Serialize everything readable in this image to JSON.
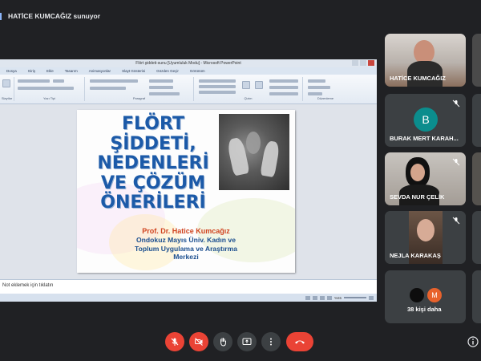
{
  "presenter": {
    "label": "HATİCE KUMCAĞIZ sunuyor"
  },
  "powerpoint": {
    "window_title": "Flört şiddeti-sunu [Uyumluluk Modu] - Microsoft PowerPoint",
    "ribbon_tabs": [
      "Dosya",
      "Giriş",
      "Ekle",
      "Tasarım",
      "Animasyonlar",
      "Slayt Gösterisi",
      "Gözden Geçir",
      "Görünüm"
    ],
    "ribbon_groups": [
      "Slaytlar",
      "Yazı Tipi",
      "Paragraf",
      "Çizim",
      "Düzenleme"
    ],
    "slide": {
      "title_lines": [
        "FLÖRT",
        "ŞİDDETİ,",
        "NEDENLERİ",
        "VE ÇÖZÜM",
        "ÖNERİLERİ"
      ],
      "author": "Prof. Dr. Hatice Kumcağız",
      "institution_lines": [
        "Ondokuz Mayıs Üniv. Kadın ve",
        "Toplum Uygulama ve Araştırma",
        "Merkezi"
      ]
    },
    "notes_placeholder": "Not eklemek için tıklatın",
    "zoom": "%65"
  },
  "participants": [
    {
      "name": "HATİCE KUMCAĞIZ",
      "type": "video"
    },
    {
      "name": "BURAK MERT KARAH...",
      "type": "avatar",
      "initial": "B",
      "avatar_color": "#0b8d8d",
      "muted": true
    },
    {
      "name": "SEVDA NUR ÇELİK",
      "type": "video",
      "muted": true
    },
    {
      "name": "NEJLA KARAKAŞ",
      "type": "video",
      "muted": true
    },
    {
      "name": "38 kişi daha",
      "type": "more",
      "initial": "M",
      "avatar_color": "#e8622c"
    }
  ],
  "controls": {
    "mic": "mic-off-icon",
    "camera": "camera-off-icon",
    "raise_hand": "hand-icon",
    "present": "present-icon",
    "more": "more-options-icon",
    "leave": "hang-up-icon"
  },
  "colors": {
    "danger": "#ea4335",
    "tile": "#3c4043",
    "background": "#202124",
    "slide_title": "#1c5aa8",
    "slide_author": "#d0431f"
  }
}
